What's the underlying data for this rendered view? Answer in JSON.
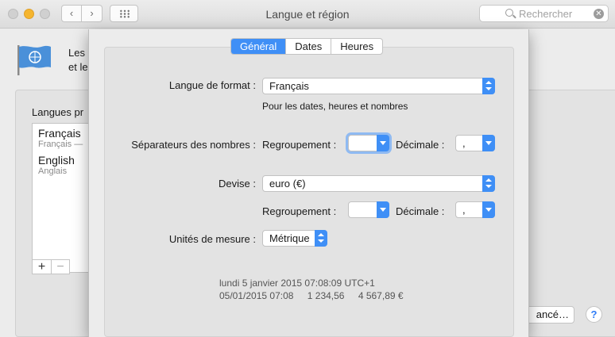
{
  "window": {
    "title": "Langue et région"
  },
  "search": {
    "placeholder": "Rechercher"
  },
  "background": {
    "intro_line1": "Les",
    "intro_line2": "et le",
    "languages_title": "Langues pr",
    "languages": [
      {
        "name": "Français",
        "subtitle": "Français —"
      },
      {
        "name": "English",
        "subtitle": "Anglais"
      }
    ],
    "add_label": "+",
    "remove_label": "−",
    "advanced_label": "ancé…",
    "help_label": "?"
  },
  "sheet": {
    "tabs": [
      "Général",
      "Dates",
      "Heures"
    ],
    "active_tab": "Général",
    "format_language": {
      "label": "Langue de format :",
      "value": "Français",
      "note": "Pour les dates, heures et nombres"
    },
    "number_separators": {
      "label": "Séparateurs des nombres :",
      "grouping_label": "Regroupement :",
      "grouping_value": "",
      "decimal_label": "Décimale :",
      "decimal_value": ","
    },
    "currency": {
      "label": "Devise :",
      "value": "euro (€)",
      "grouping_label": "Regroupement :",
      "grouping_value": "",
      "decimal_label": "Décimale :",
      "decimal_value": ","
    },
    "units": {
      "label": "Unités de mesure :",
      "value": "Métrique"
    },
    "sample": {
      "line1": "lundi 5 janvier 2015 07:08:09 UTC+1",
      "date": "05/01/2015 07:08",
      "number": "1 234,56",
      "currency": "4 567,89 €"
    }
  },
  "colors": {
    "accent": "#3f8ff6",
    "focus_ring": "#8fbaf2"
  }
}
